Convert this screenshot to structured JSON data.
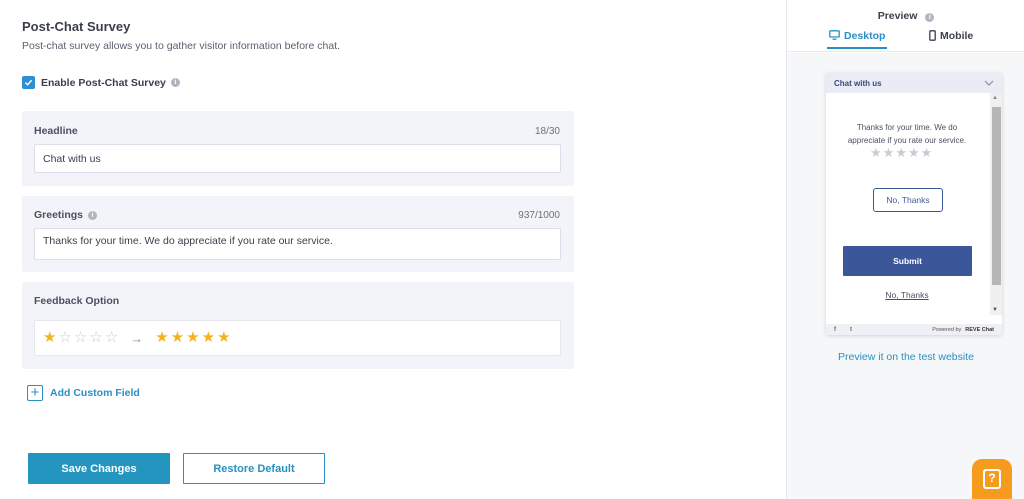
{
  "section": {
    "title": "Post-Chat Survey",
    "description": "Post-chat survey allows you to gather visitor information before chat."
  },
  "enable": {
    "label": "Enable Post-Chat Survey",
    "checked": true
  },
  "headline": {
    "label": "Headline",
    "counter": "18/30",
    "value": "Chat with us"
  },
  "greetings": {
    "label": "Greetings",
    "counter": "937/1000",
    "value": "Thanks for your time. We do appreciate if you rate our service."
  },
  "feedback": {
    "label": "Feedback Option",
    "from_rating": 1,
    "to_rating": 5,
    "max_rating": 5
  },
  "add_custom_field": {
    "label": "Add Custom Field"
  },
  "buttons": {
    "save": "Save Changes",
    "restore": "Restore Default"
  },
  "preview": {
    "title": "Preview",
    "tabs": [
      {
        "label": "Desktop",
        "active": true
      },
      {
        "label": "Mobile",
        "active": false
      }
    ],
    "widget": {
      "header_title": "Chat with us",
      "greeting": "Thanks for your time. We do appreciate if you rate our service.",
      "stars": 5,
      "no_thanks_button": "No, Thanks",
      "submit_button": "Submit",
      "no_thanks_link": "No, Thanks",
      "footer_facebook": "f",
      "footer_twitter": "t",
      "powered_by": "Powered by",
      "brand": "REVE Chat"
    },
    "test_link": "Preview it on the test website"
  },
  "colors": {
    "accent": "#2a8fc4",
    "save_button": "#2495be",
    "star_filled": "#f5b31b",
    "widget_submit": "#3c5799",
    "help_button": "#f59b1d"
  }
}
